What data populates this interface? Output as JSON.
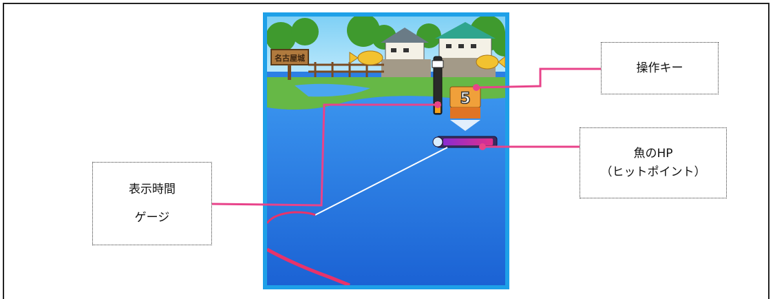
{
  "callouts": {
    "operation_key": "操作キー",
    "fish_hp_line1": "魚のHP",
    "fish_hp_line2": "（ヒットポイント）",
    "display_time_gauge_line1": "表示時間",
    "display_time_gauge_line2": "ゲージ"
  },
  "game": {
    "signboard_text": "名古屋城",
    "key_number": "5",
    "timer_gauge_level": 0.2,
    "fish_hp_level": 0.95
  },
  "colors": {
    "leader_line": "#e8438a",
    "game_border": "#1ea0e8",
    "water": "#2c7fe4",
    "hp_bar": "#d12a8a"
  }
}
